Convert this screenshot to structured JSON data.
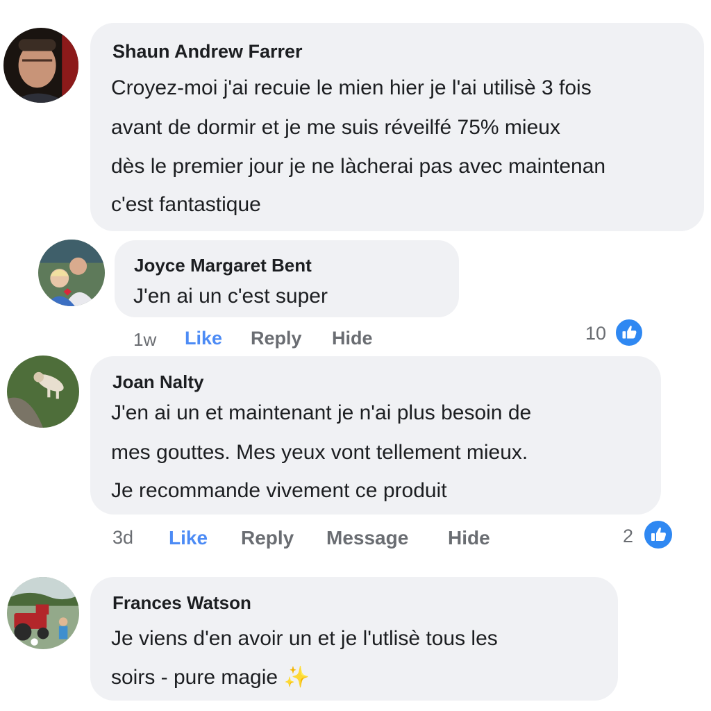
{
  "comments": [
    {
      "author": "Shaun Andrew Farrer",
      "lines": [
        "Croyez-moi j'ai recuie le mien hier je l'ai utilisè 3 fois",
        "avant de dormir et je me suis réveilfé 75% mieux",
        "dès le premier jour je ne làcherai pas avec maintenan",
        "c'est fantastique"
      ]
    },
    {
      "author": "Joyce Margaret Bent",
      "lines": [
        "J'en ai un c'est super"
      ],
      "time": "1w",
      "actions": {
        "like": "Like",
        "reply": "Reply",
        "hide": "Hide"
      },
      "reaction_count": "10"
    },
    {
      "author": "Joan Nalty",
      "lines": [
        "J'en ai un et maintenant je n'ai plus besoin de",
        "mes gouttes. Mes yeux vont tellement mieux.",
        "Je recommande vivement ce produit"
      ],
      "time": "3d",
      "actions": {
        "like": "Like",
        "reply": "Reply",
        "message": "Message",
        "hide": "Hide"
      },
      "reaction_count": "2"
    },
    {
      "author": "Frances Watson",
      "lines": [
        "Je viens d'en avoir un et je l'utlisè tous les",
        "soirs - pure magie"
      ],
      "emoji": "✨"
    }
  ],
  "colors": {
    "bubble": "#f0f1f4",
    "like_blue": "#2f88f2",
    "action_gray": "#6a6d72"
  }
}
